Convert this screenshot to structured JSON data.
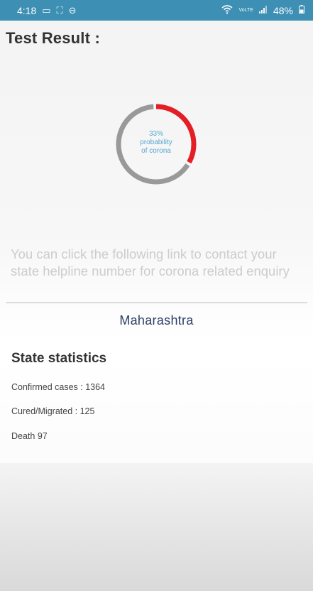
{
  "status_bar": {
    "time": "4:18",
    "battery": "48%",
    "bg_color": "#3d8fb4",
    "icons_left": [
      "screen-icon",
      "expand-icon",
      "minus-circle-icon"
    ],
    "icons_right": [
      "wifi-icon",
      "volte-icon",
      "signal-icon",
      "battery-icon"
    ]
  },
  "page": {
    "title": "Test Result :"
  },
  "result_ring": {
    "probability_percent": 33,
    "line1": "33%",
    "line2": "probability",
    "line3": "of corona",
    "active_color": "#e41e26",
    "track_color": "#999999"
  },
  "helpline": {
    "text": "You can click the following link to contact your state helpline number for corona related enquiry",
    "state_link": "Maharashtra"
  },
  "state_statistics": {
    "heading": "State statistics",
    "confirmed": "Confirmed cases : 1364",
    "cured": "Cured/Migrated : 125",
    "death": "Death 97"
  }
}
